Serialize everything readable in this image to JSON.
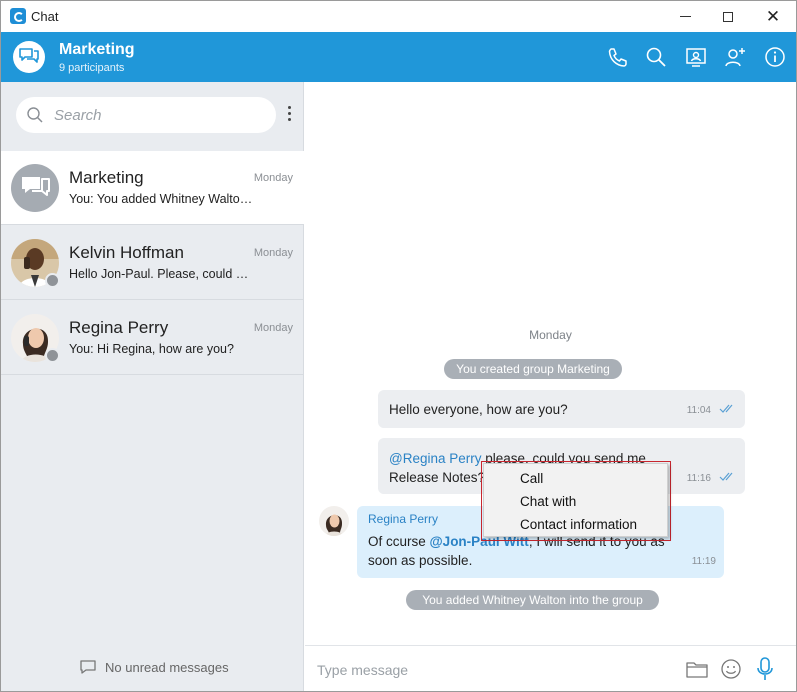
{
  "window": {
    "title": "Chat",
    "colors": {
      "accent": "#2097d9",
      "sidebar_bg": "#e9ecf0",
      "mention": "#2a82c5"
    }
  },
  "header": {
    "group_name": "Marketing",
    "participants": "9 participants",
    "icons": [
      "phone-icon",
      "search-icon",
      "contact-card-icon",
      "add-user-icon",
      "info-icon"
    ]
  },
  "sidebar": {
    "search_placeholder": "Search",
    "conversations": [
      {
        "name": "Marketing",
        "time": "Monday",
        "preview": "You: You added Whitney Walton into the group",
        "active": true
      },
      {
        "name": "Kelvin Hoffman",
        "time": "Monday",
        "preview": "Hello Jon-Paul. Please, could you send me",
        "active": false
      },
      {
        "name": "Regina Perry",
        "time": "Monday",
        "preview": "You: Hi Regina, how are you?",
        "active": false
      }
    ],
    "footer": "No unread messages"
  },
  "chat": {
    "day": "Monday",
    "system_created": "You created group Marketing",
    "messages": [
      {
        "text": "Hello everyone, how are you?",
        "time": "11:04"
      },
      {
        "mention": "@Regina Perry",
        "text_after_mention": " please, could you send me",
        "line2": "Release Notes? Than",
        "time": "11:16"
      },
      {
        "sender": "Regina Perry",
        "line1_before": "Of ccurse ",
        "mention": "@Jon-Paul Witt",
        "line1_after": ", I will send it to you as",
        "line2": "soon as possible.",
        "time": "11:19"
      }
    ],
    "system_added": "You added Whitney Walton into the group"
  },
  "composer": {
    "placeholder": "Type message",
    "icons": [
      "folder-icon",
      "emoji-icon",
      "microphone-icon"
    ]
  },
  "context_menu": {
    "items": [
      "Call",
      "Chat with",
      "Contact information"
    ]
  }
}
